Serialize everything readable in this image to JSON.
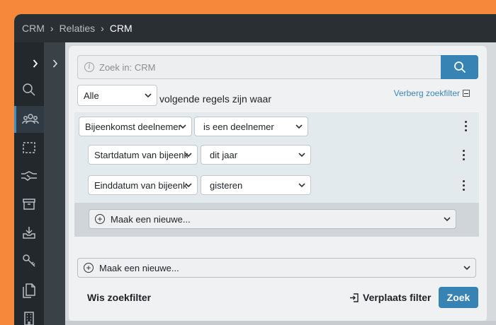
{
  "breadcrumb": {
    "items": [
      "CRM",
      "Relaties"
    ],
    "current": "CRM",
    "separator": "›"
  },
  "sidebar": {
    "expand_icon": "chevron-right-icon",
    "items": [
      {
        "icon": "search-icon"
      },
      {
        "icon": "people-icon",
        "active": true
      },
      {
        "icon": "dashed-selection-icon"
      },
      {
        "icon": "handshake-icon"
      },
      {
        "icon": "archive-box-icon"
      },
      {
        "icon": "download-tray-icon"
      },
      {
        "icon": "key-icon"
      },
      {
        "icon": "document-stack-icon"
      },
      {
        "icon": "building-icon"
      }
    ]
  },
  "subnav": {
    "toggle_icon": "chevron-right-icon"
  },
  "search": {
    "placeholder": "Zoek in: CRM",
    "button_icon": "search-icon"
  },
  "filter": {
    "match_mode": "Alle",
    "match_text": "volgende regels zijn waar",
    "hide_link": "Verberg zoekfilter",
    "group": {
      "field": "Bijeenkomst deelnemer",
      "operator": "is een deelnemer",
      "rules": [
        {
          "field": "Startdatum van bijeenkomst",
          "value": "dit jaar"
        },
        {
          "field": "Einddatum van bijeenkomst",
          "value": "gisteren"
        }
      ],
      "add_label": "Maak een nieuwe..."
    },
    "add_label": "Maak een nieuwe...",
    "clear_label": "Wis zoekfilter",
    "move_label": "Verplaats filter",
    "submit_label": "Zoek"
  },
  "colors": {
    "accent": "#3683b4",
    "frame": "#f5883a",
    "topbar": "#2a2f33",
    "link": "#3b86b9"
  }
}
